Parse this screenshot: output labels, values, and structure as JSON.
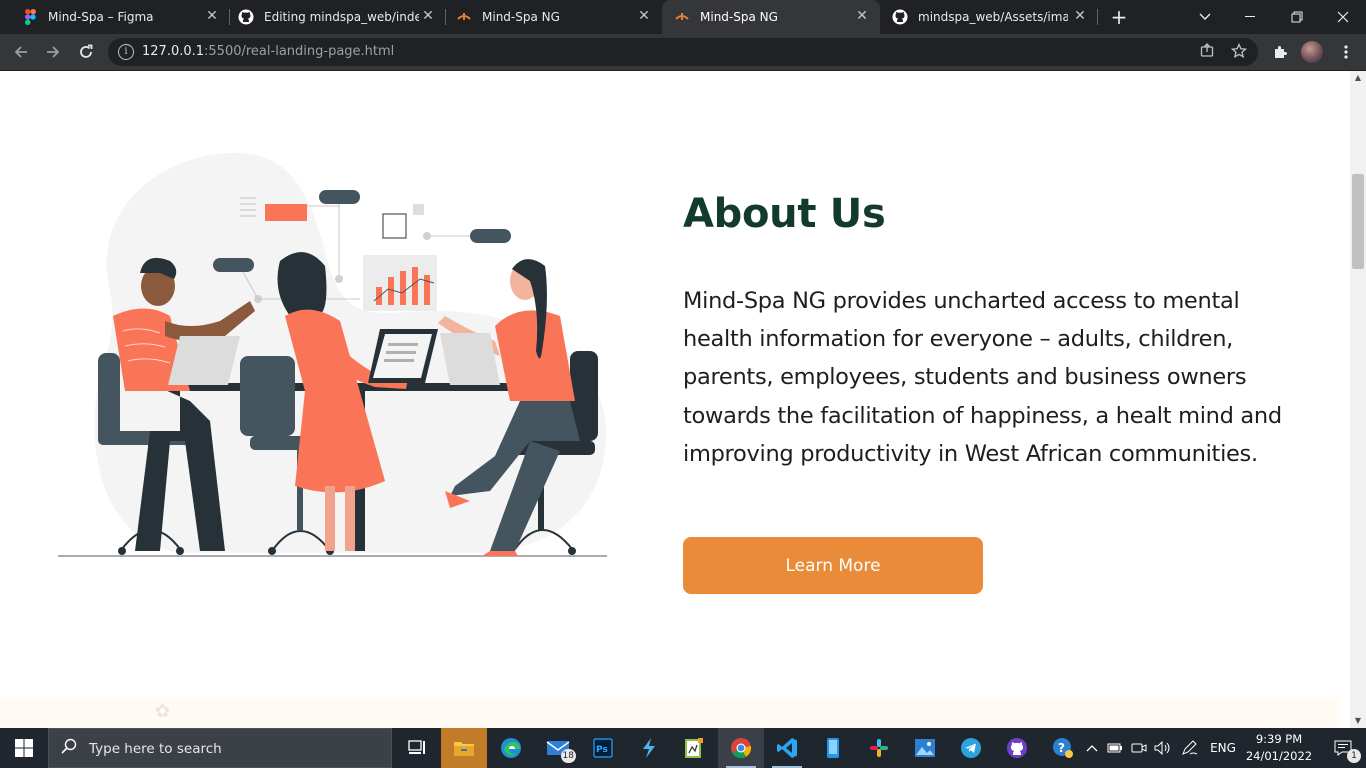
{
  "browser": {
    "tabs": [
      {
        "title": "Mind-Spa – Figma",
        "favicon": "figma-icon"
      },
      {
        "title": "Editing mindspa_web/index.html",
        "favicon": "github-icon"
      },
      {
        "title": "Mind-Spa NG",
        "favicon": "mindspa-icon"
      },
      {
        "title": "Mind-Spa NG",
        "favicon": "mindspa-icon",
        "active": true
      },
      {
        "title": "mindspa_web/Assets/images",
        "favicon": "github-icon"
      }
    ],
    "address": {
      "host": "127.0.0.1",
      "path": ":5500/real-landing-page.html"
    }
  },
  "about": {
    "title": "About Us",
    "body": "Mind-Spa NG provides uncharted access to mental health information for everyone – adults, children, parents, employees, students and business owners towards the facilitation of happiness, a healt mind and improving productivity in West African communities.",
    "cta": "Learn More"
  },
  "taskbar": {
    "search_placeholder": "Type here to search",
    "mail_badge": "18",
    "language": "ENG",
    "time": "9:39 PM",
    "date": "24/01/2022",
    "notifications": "1"
  },
  "colors": {
    "heading": "#123a2e",
    "cta": "#ea8b3a",
    "illustration_accent": "#fa7557"
  }
}
